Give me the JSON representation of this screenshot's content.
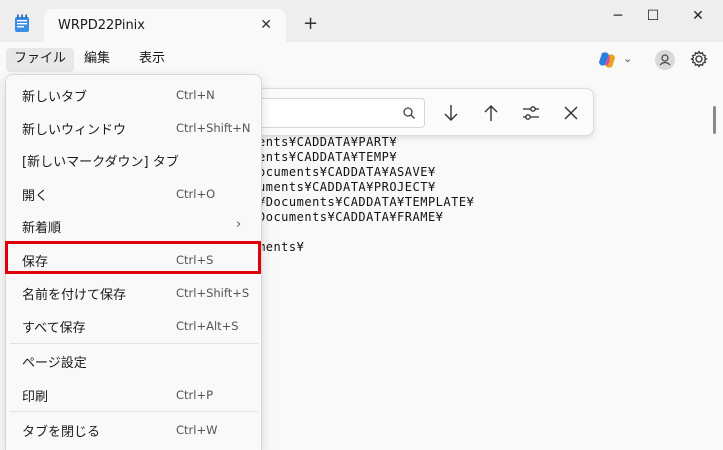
{
  "window": {
    "tab_title": "WRPD22Pinix",
    "tab_close": "✕",
    "new_tab": "+",
    "minimize": "─",
    "maximize": "☐",
    "close": "✕"
  },
  "menubar": {
    "file": "ファイル",
    "edit": "編集",
    "view": "表示",
    "chevron": "⌄"
  },
  "editor": {
    "lines": [
      "ents¥CADDATA¥PART¥",
      "ents¥CADDATA¥TEMP¥",
      "ocuments¥CADDATA¥ASAVE¥",
      "uments¥CADDATA¥PROJECT¥",
      "¥Documents¥CADDATA¥TEMPLATE¥",
      "Documents¥CADDATA¥FRAME¥",
      "",
      "ments¥"
    ]
  },
  "file_menu": {
    "items": [
      {
        "label": "新しいタブ",
        "shortcut": "Ctrl+N"
      },
      {
        "label": "新しいウィンドウ",
        "shortcut": "Ctrl+Shift+N"
      },
      {
        "label": "[新しいマークダウン] タブ",
        "shortcut": ""
      },
      {
        "label": "開く",
        "shortcut": "Ctrl+O"
      },
      {
        "label": "新着順",
        "shortcut": "",
        "submenu_arrow": "›"
      },
      {
        "label": "保存",
        "shortcut": "Ctrl+S"
      },
      {
        "label": "名前を付けて保存",
        "shortcut": "Ctrl+Shift+S"
      },
      {
        "label": "すべて保存",
        "shortcut": "Ctrl+Alt+S"
      },
      {
        "label": "ページ設定",
        "shortcut": ""
      },
      {
        "label": "印刷",
        "shortcut": "Ctrl+P"
      },
      {
        "label": "タブを閉じる",
        "shortcut": "Ctrl+W"
      }
    ]
  },
  "colors": {
    "highlight": "#e0000a",
    "accent": "#0067c0"
  },
  "icons": {
    "app": "notepad-icon",
    "copilot": "copilot-icon",
    "account": "account-icon",
    "settings": "gear-icon",
    "search": "search-icon",
    "next": "arrow-down-icon",
    "previous": "arrow-up-icon",
    "options": "sliders-icon",
    "close_find": "close-icon"
  }
}
